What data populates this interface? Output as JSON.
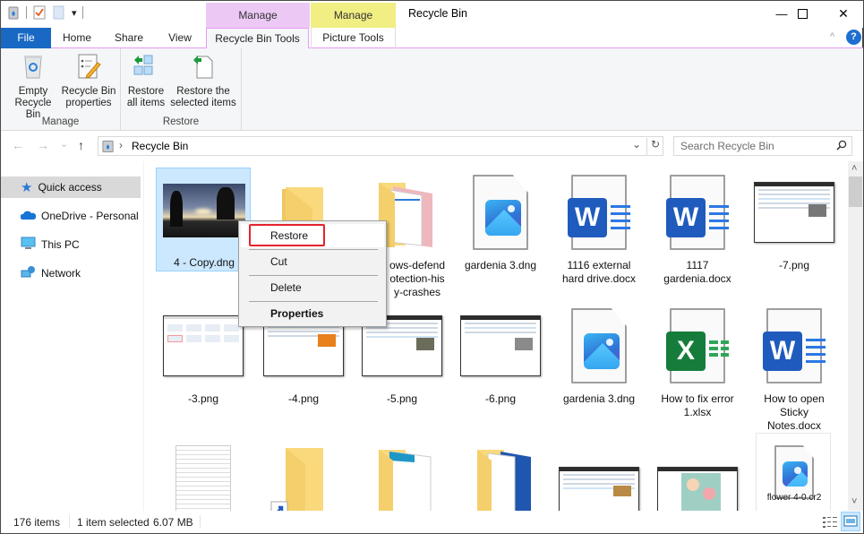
{
  "window": {
    "title": "Recycle Bin",
    "minimize_glyph": "—",
    "maximize_glyph": "☐",
    "close_glyph": "✕"
  },
  "qat": {
    "icons": [
      "recycle-bin-icon",
      "properties-check-icon",
      "new-folder-icon",
      "customize-qat-dropdown-icon"
    ],
    "dropdown_glyph": "▾"
  },
  "contextual_tabs": [
    {
      "header": "Manage",
      "tab": "Recycle Bin Tools",
      "color": "#ecc9f5"
    },
    {
      "header": "Manage",
      "tab": "Picture Tools",
      "color": "#f1ee84"
    }
  ],
  "tabs": [
    {
      "label": "File",
      "color": "#1969c4"
    },
    {
      "label": "Home"
    },
    {
      "label": "Share"
    },
    {
      "label": "View"
    }
  ],
  "ribbon": {
    "collapse_glyph": "^",
    "help_glyph": "?",
    "groups": [
      {
        "label": "Manage",
        "buttons": [
          {
            "line1": "Empty",
            "line2": "Recycle Bin",
            "icon": "empty-recycle-bin-icon"
          },
          {
            "line1": "Recycle Bin",
            "line2": "properties",
            "icon": "recycle-bin-properties-icon"
          }
        ]
      },
      {
        "label": "Restore",
        "buttons": [
          {
            "line1": "Restore",
            "line2": "all items",
            "icon": "restore-all-icon"
          },
          {
            "line1": "Restore the",
            "line2": "selected items",
            "icon": "restore-selected-icon"
          }
        ]
      }
    ]
  },
  "nav": {
    "back": "←",
    "forward": "→",
    "recent": "⌄",
    "up": "↑",
    "breadcrumb_sep": "›",
    "path": "Recycle Bin",
    "dropdown": "⌄",
    "refresh": "↻",
    "search_placeholder": "Search Recycle Bin"
  },
  "sidebar": {
    "items": [
      {
        "label": "Quick access",
        "icon": "star-icon",
        "selected": true
      },
      {
        "label": "OneDrive - Personal",
        "icon": "cloud-icon"
      },
      {
        "label": "This PC",
        "icon": "monitor-icon"
      },
      {
        "label": "Network",
        "icon": "network-icon"
      }
    ]
  },
  "files": [
    {
      "name": "4 - Copy.dng",
      "type": "photo",
      "selected": true
    },
    {
      "name": "",
      "type": "folder"
    },
    {
      "name": "windows-defender-protection-history-crashes",
      "visible_lines": [
        "ows-defend",
        "otection-his",
        "y-crashes"
      ],
      "type": "folder-preview"
    },
    {
      "name": "gardenia 3.dng",
      "type": "image-file"
    },
    {
      "name": "1116 external hard drive.docx",
      "lines": [
        "1116 external",
        "hard drive.docx"
      ],
      "type": "word"
    },
    {
      "name": "1117 gardenia.docx",
      "lines": [
        "1117",
        "gardenia.docx"
      ],
      "type": "word"
    },
    {
      "name": "-7.png",
      "type": "screenshot"
    },
    {
      "name": "-3.png",
      "type": "screenshot"
    },
    {
      "name": "-4.png",
      "type": "screenshot"
    },
    {
      "name": "-5.png",
      "type": "screenshot"
    },
    {
      "name": "-6.png",
      "type": "screenshot"
    },
    {
      "name": "gardenia 3.dng",
      "type": "image-file"
    },
    {
      "name": "How to fix error 1.xlsx",
      "lines": [
        "How to fix error",
        "1.xlsx"
      ],
      "type": "excel"
    },
    {
      "name": "How to open Sticky Notes.docx",
      "lines": [
        "How to open",
        "Sticky",
        "Notes.docx"
      ],
      "type": "word"
    },
    {
      "name": "",
      "type": "text-file"
    },
    {
      "name": "",
      "type": "folder-shortcut"
    },
    {
      "name": "",
      "type": "folder-preview"
    },
    {
      "name": "",
      "type": "folder-preview"
    },
    {
      "name": "",
      "type": "screenshot"
    },
    {
      "name": "",
      "type": "screenshot"
    },
    {
      "name": "flower 4-0.cr2",
      "type": "image-file"
    }
  ],
  "context_menu": {
    "items": [
      {
        "label": "Restore",
        "highlighted": true
      },
      {
        "label": "Cut"
      },
      {
        "label": "Delete"
      },
      {
        "label": "Properties",
        "bold": true
      }
    ],
    "highlight_color": "#e5222c"
  },
  "scrollbar": {
    "up": "˄",
    "down": "˅",
    "position_fraction": 0.0
  },
  "status": {
    "item_count": "176 items",
    "selection": "1 item selected",
    "size": "6.07 MB"
  },
  "view_buttons": [
    {
      "name": "details-view",
      "active": false
    },
    {
      "name": "large-icons-view",
      "active": true
    }
  ]
}
